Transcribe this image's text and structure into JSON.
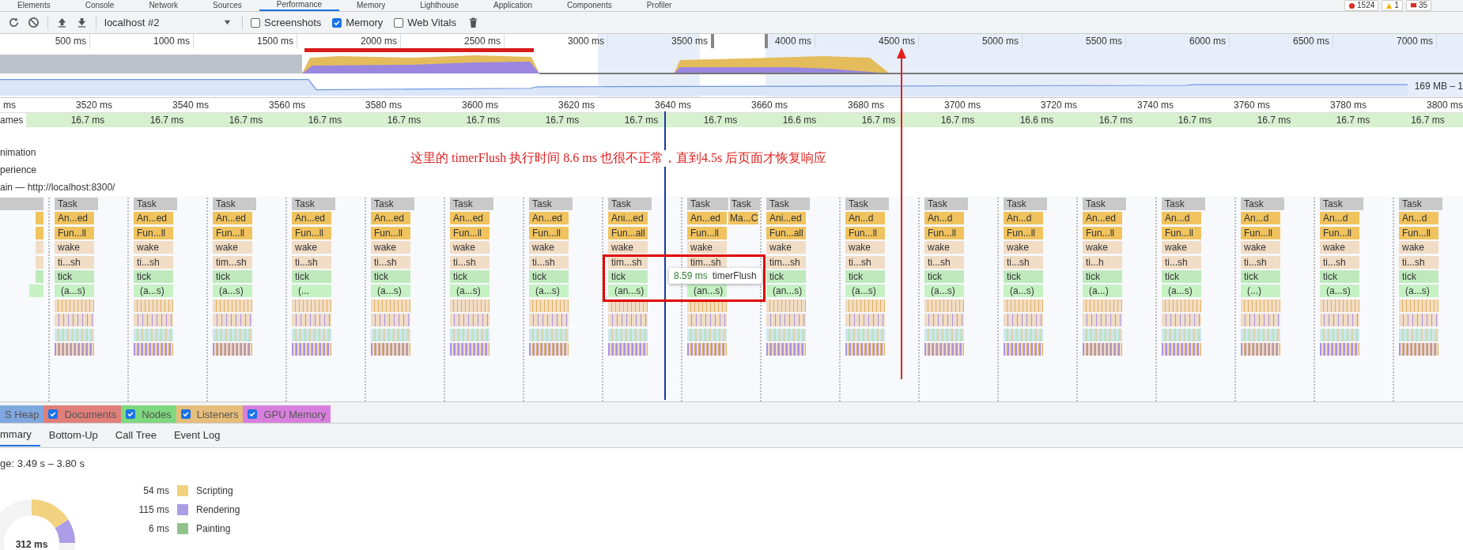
{
  "devtools_tabs": [
    {
      "label": "Elements",
      "selected": false
    },
    {
      "label": "Console",
      "selected": false
    },
    {
      "label": "Network",
      "selected": false
    },
    {
      "label": "Sources",
      "selected": false
    },
    {
      "label": "Performance",
      "selected": true
    },
    {
      "label": "Memory",
      "selected": false
    },
    {
      "label": "Lighthouse",
      "selected": false
    },
    {
      "label": "Application",
      "selected": false
    },
    {
      "label": "Components",
      "selected": false
    },
    {
      "label": "Profiler",
      "selected": false
    }
  ],
  "status_badges": [
    {
      "kind": "error",
      "count": "1524"
    },
    {
      "kind": "warning",
      "count": "1"
    },
    {
      "kind": "message",
      "count": "35"
    }
  ],
  "toolbar": {
    "profile_select": "localhost #2",
    "options": [
      {
        "label": "Screenshots",
        "checked": false
      },
      {
        "label": "Memory",
        "checked": true
      },
      {
        "label": "Web Vitals",
        "checked": false
      }
    ]
  },
  "overview": {
    "time_labels": [
      "500 ms",
      "1000 ms",
      "1500 ms",
      "2000 ms",
      "2500 ms",
      "3000 ms",
      "3500 ms",
      "4000 ms",
      "4500 ms",
      "5000 ms",
      "5500 ms",
      "6000 ms",
      "6500 ms",
      "7000 ms"
    ],
    "memory_range": "169 MB – 1"
  },
  "ruler_labels": [
    "ms",
    "3520 ms",
    "3540 ms",
    "3560 ms",
    "3580 ms",
    "3600 ms",
    "3620 ms",
    "3640 ms",
    "3660 ms",
    "3680 ms",
    "3700 ms",
    "3720 ms",
    "3740 ms",
    "3760 ms",
    "3780 ms",
    "3800 ms"
  ],
  "frames": {
    "label": "ames",
    "durations": [
      "16.7 ms",
      "16.7 ms",
      "16.7 ms",
      "16.7 ms",
      "16.7 ms",
      "16.7 ms",
      "16.7 ms",
      "16.7 ms",
      "16.7 ms",
      "16.6 ms",
      "16.7 ms",
      "16.7 ms",
      "16.6 ms",
      "16.7 ms",
      "16.7 ms",
      "16.7 ms",
      "16.7 ms",
      "16.7 ms"
    ]
  },
  "tracks": [
    "nimation",
    "perience",
    "ain — http://localhost:8300/"
  ],
  "flame_columns": [
    {
      "task": "Task",
      "animation": "An...ed",
      "function": "Fun...ll",
      "wake": "wake",
      "timer": "ti...sh",
      "tick": "tick",
      "anonymous": "(a...s)"
    },
    {
      "task": "Task",
      "animation": "An...ed",
      "function": "Fun...ll",
      "wake": "wake",
      "timer": "ti...sh",
      "tick": "tick",
      "anonymous": "(a...s)"
    },
    {
      "task": "Task",
      "animation": "An...ed",
      "function": "Fun...ll",
      "wake": "wake",
      "timer": "tim...sh",
      "tick": "tick",
      "anonymous": "(a...s)"
    },
    {
      "task": "Task",
      "animation": "An...ed",
      "function": "Fun...ll",
      "wake": "wake",
      "timer": "ti...sh",
      "tick": "tick",
      "anonymous": "(..."
    },
    {
      "task": "Task",
      "animation": "An...ed",
      "function": "Fun...ll",
      "wake": "wake",
      "timer": "ti...sh",
      "tick": "tick",
      "anonymous": "(a...s)"
    },
    {
      "task": "Task",
      "animation": "An...ed",
      "function": "Fun...ll",
      "wake": "wake",
      "timer": "ti...sh",
      "tick": "tick",
      "anonymous": "(a...s)"
    },
    {
      "task": "Task",
      "animation": "An...ed",
      "function": "Fun...ll",
      "wake": "wake",
      "timer": "ti...sh",
      "tick": "tick",
      "anonymous": "(a...s)"
    },
    {
      "task": "Task",
      "animation": "Ani...ed",
      "function": "Fun...all",
      "wake": "wake",
      "timer": "tim...sh",
      "tick": "tick",
      "anonymous": "(an...s)"
    },
    {
      "task": "Task",
      "animation": "An...ed",
      "function": "Fun...ll",
      "wake": "wake",
      "timer": "tim...sh",
      "anonymous": "(an...s)",
      "extra_task": "Task",
      "extra_event": "Ma...C"
    },
    {
      "task": "Task",
      "animation": "Ani...ed",
      "function": "Fun...all",
      "wake": "wake",
      "timer": "tim...sh",
      "tick": "tick",
      "anonymous": "(an...s)"
    },
    {
      "task": "Task",
      "animation": "An...d",
      "function": "Fun...ll",
      "wake": "wake",
      "timer": "ti...sh",
      "tick": "tick",
      "anonymous": "(a...s)"
    },
    {
      "task": "Task",
      "animation": "An...d",
      "function": "Fun...ll",
      "wake": "wake",
      "timer": "ti...sh",
      "tick": "tick",
      "anonymous": "(a...s)"
    },
    {
      "task": "Task",
      "animation": "An...d",
      "function": "Fun...ll",
      "wake": "wake",
      "timer": "ti...sh",
      "tick": "tick",
      "anonymous": "(a...s)"
    },
    {
      "task": "Task",
      "animation": "An...ed",
      "function": "Fun...ll",
      "wake": "wake",
      "timer": "ti...h",
      "tick": "tick",
      "anonymous": "(a...)"
    },
    {
      "task": "Task",
      "animation": "An...d",
      "function": "Fun...ll",
      "wake": "wake",
      "timer": "ti...sh",
      "tick": "tick",
      "anonymous": "(a...s)"
    },
    {
      "task": "Task",
      "animation": "An...d",
      "function": "Fun...ll",
      "wake": "wake",
      "timer": "ti...sh",
      "tick": "tick",
      "anonymous": "(...)"
    },
    {
      "task": "Task",
      "animation": "An...d",
      "function": "Fun...ll",
      "wake": "wake",
      "timer": "ti...sh",
      "tick": "tick",
      "anonymous": "(a...s)"
    },
    {
      "task": "Task",
      "animation": "An...d",
      "function": "Fun...ll",
      "wake": "wake",
      "timer": "ti...sh",
      "tick": "tick",
      "anonymous": "(a...s)"
    }
  ],
  "tooltip": {
    "duration": "8.59 ms",
    "name": "timerFlush"
  },
  "annotation": "这里的 timerFlush 执行时间 8.6 ms 也很不正常，直到4.5s 后页面才恢复响应",
  "memory_counters": [
    {
      "label": "S Heap",
      "color": "#7fa7e0"
    },
    {
      "label": "Documents",
      "color": "#e07f7a",
      "checked": true
    },
    {
      "label": "Nodes",
      "color": "#7ed87e",
      "checked": true
    },
    {
      "label": "Listeners",
      "color": "#e6bd7a",
      "checked": true
    },
    {
      "label": "GPU Memory",
      "color": "#d87fde",
      "checked": true
    }
  ],
  "detail_tabs": [
    {
      "label": "mmary",
      "selected": true
    },
    {
      "label": "Bottom-Up",
      "selected": false
    },
    {
      "label": "Call Tree",
      "selected": false
    },
    {
      "label": "Event Log",
      "selected": false
    }
  ],
  "summary": {
    "range": "ge: 3.49 s – 3.80 s",
    "total": "312 ms",
    "categories": [
      {
        "time": "54 ms",
        "name": "Scripting",
        "color": "#f2d27f"
      },
      {
        "time": "115 ms",
        "name": "Rendering",
        "color": "#ab9de6"
      },
      {
        "time": "6 ms",
        "name": "Painting",
        "color": "#8fc28b"
      }
    ]
  }
}
